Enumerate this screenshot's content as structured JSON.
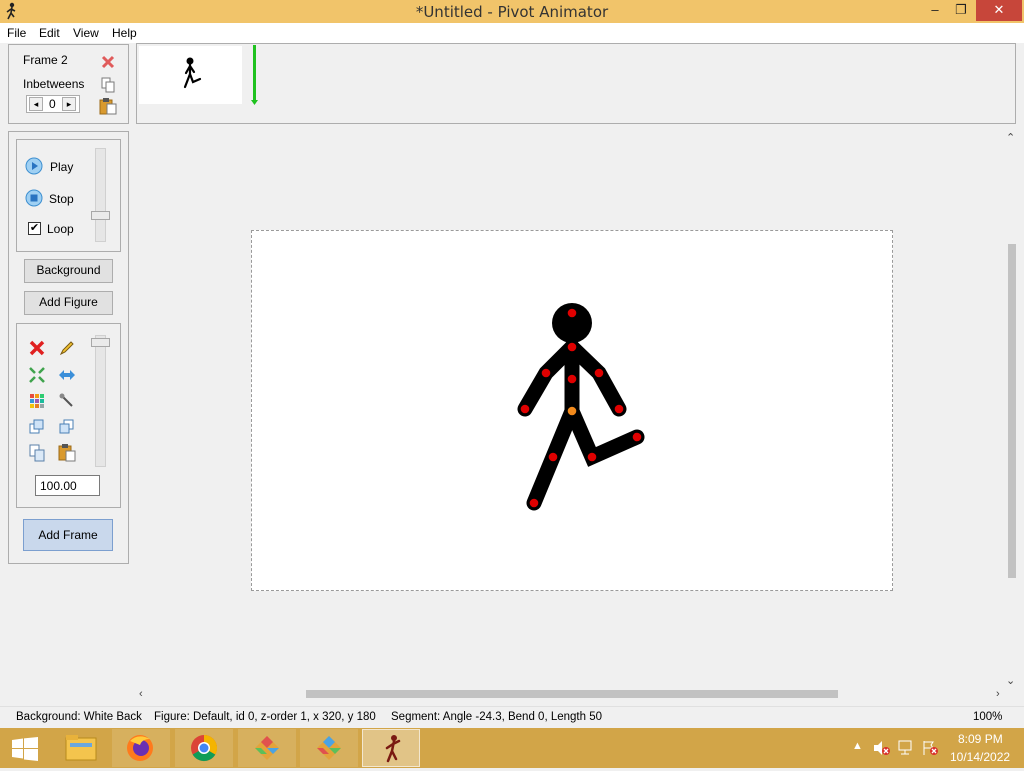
{
  "window": {
    "title": "*Untitled - Pivot Animator",
    "minimize": "–",
    "maximize": "❐",
    "close": "✕"
  },
  "menu": [
    "File",
    "Edit",
    "View",
    "Help"
  ],
  "frame_panel": {
    "frame_label": "Frame 2",
    "inbetweens_label": "Inbetweens",
    "inbetweens_value": "0",
    "dec": "◂",
    "inc": "▸"
  },
  "playback": {
    "play": "Play",
    "stop": "Stop",
    "loop": "Loop",
    "loop_checked": true
  },
  "buttons": {
    "background": "Background",
    "add_figure": "Add Figure",
    "add_frame": "Add Frame"
  },
  "tools": {
    "scale_value": "100.00",
    "icons": [
      "delete-icon",
      "edit-icon",
      "center-icon",
      "flip-icon",
      "color-icon",
      "joint-tool-icon",
      "front-icon",
      "back-icon",
      "copy-icon",
      "paste-icon"
    ]
  },
  "status": {
    "background": "Background: White Back",
    "figure": "Figure: Default,  id 0,  z-order 1,  x 320, y 180",
    "segment": "Segment: Angle -24.3,  Bend 0,  Length 50",
    "zoom": "100%"
  },
  "taskbar": {
    "time": "8:09 PM",
    "date": "10/14/2022",
    "apps": [
      "start-icon",
      "file-explorer-icon",
      "firefox-icon",
      "chrome-icon",
      "app-icon",
      "app-icon",
      "pivot-animator-icon"
    ]
  },
  "colors": {
    "titlebar": "#f1c46a",
    "taskbar": "#d2a548",
    "joint": "#e00000",
    "origin_joint": "#f28a1c",
    "timeline_cursor": "#1fc21f"
  }
}
